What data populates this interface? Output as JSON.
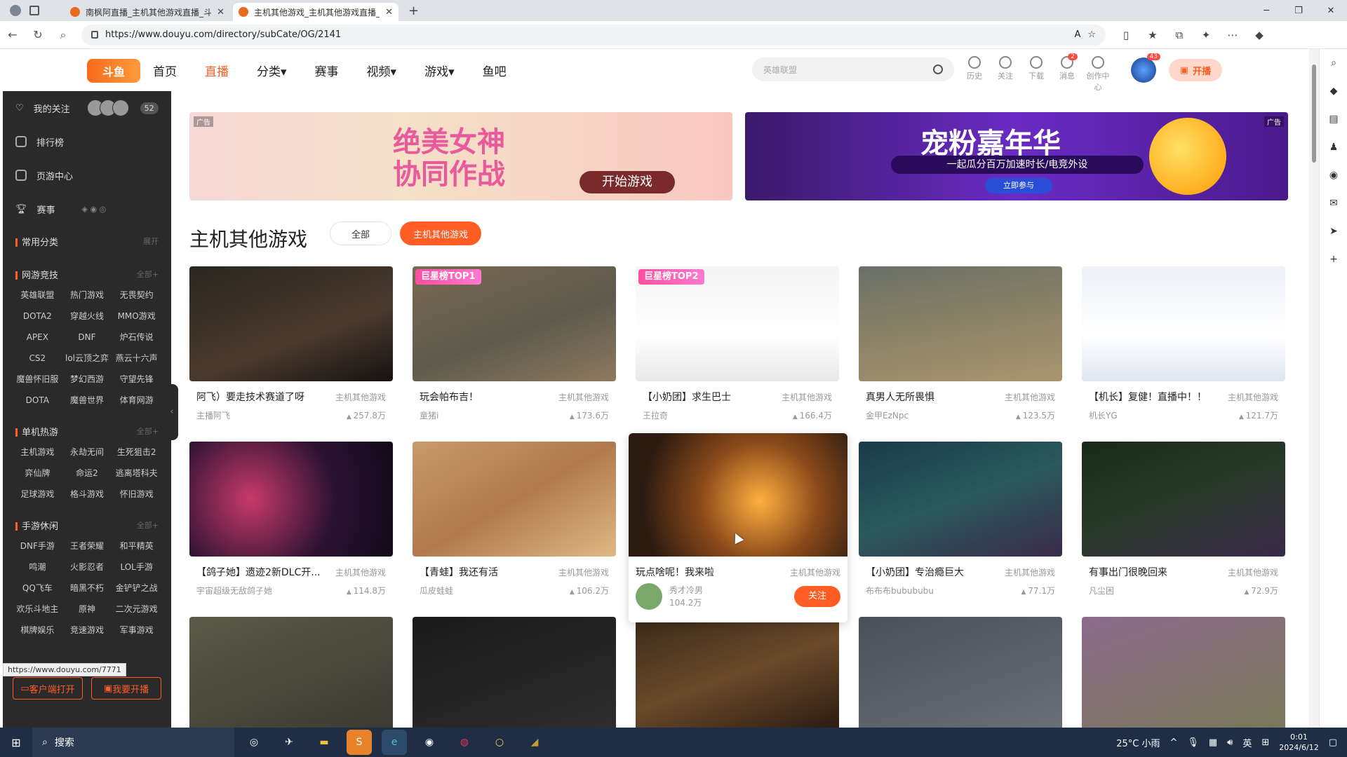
{
  "browser": {
    "tabs": [
      {
        "title": "南枫阿直播_主机其他游戏直播_斗鱼直播",
        "active": false
      },
      {
        "title": "主机其他游戏_主机其他游戏直播_斗鱼直播",
        "active": true
      }
    ],
    "url": "https://www.douyu.com/directory/subCate/OG/2141",
    "status_url": "https://www.douyu.com/7771"
  },
  "header": {
    "logo": "斗鱼",
    "nav": [
      "首页",
      "直播",
      "分类▾",
      "赛事",
      "视频▾",
      "游戏▾",
      "鱼吧"
    ],
    "active_nav": "直播",
    "search_placeholder": "英雄联盟",
    "tools": [
      {
        "label": "历史",
        "icon": "clock-icon",
        "badge": ""
      },
      {
        "label": "关注",
        "icon": "heart-icon",
        "badge": ""
      },
      {
        "label": "下载",
        "icon": "download-icon",
        "badge": ""
      },
      {
        "label": "消息",
        "icon": "message-icon",
        "badge": "2"
      },
      {
        "label": "创作中心",
        "icon": "create-icon",
        "badge": ""
      }
    ],
    "avatar_badge": "43",
    "live_button": "开播"
  },
  "sidebar": {
    "follow_label": "我的关注",
    "follow_count": "52",
    "rank_label": "排行榜",
    "task_label": "页游中心",
    "match_label": "赛事",
    "common_label": "常用分类",
    "common_more": "展开",
    "sections": [
      {
        "title": "网游竞技",
        "more": "全部+",
        "items": [
          "英雄联盟",
          "热门游戏",
          "无畏契约",
          "DOTA2",
          "穿越火线",
          "MMO游戏",
          "APEX",
          "DNF",
          "炉石传说",
          "CS2",
          "lol云顶之弈",
          "燕云十六声",
          "魔兽怀旧服",
          "梦幻西游",
          "守望先锋",
          "DOTA",
          "魔兽世界",
          "体育网游"
        ]
      },
      {
        "title": "单机热游",
        "more": "全部+",
        "items": [
          "主机游戏",
          "永劫无间",
          "生死狙击2",
          "弈仙牌",
          "命运2",
          "逃离塔科夫",
          "足球游戏",
          "格斗游戏",
          "怀旧游戏"
        ]
      },
      {
        "title": "手游休闲",
        "more": "全部+",
        "items": [
          "DNF手游",
          "王者荣耀",
          "和平精英",
          "鸣潮",
          "火影忍者",
          "LOL手游",
          "QQ飞车",
          "暗黑不朽",
          "金铲铲之战",
          "欢乐斗地主",
          "原神",
          "二次元游戏",
          "棋牌娱乐",
          "竞速游戏",
          "军事游戏"
        ]
      }
    ],
    "btn_client": "客户端打开",
    "btn_live": "我要开播"
  },
  "banners": {
    "b1": {
      "ad": "广告",
      "title_l1": "绝美女神",
      "title_l2": "协同作战",
      "cta": "开始游戏"
    },
    "b2": {
      "ad": "广告",
      "title": "宠粉嘉年华",
      "sub": "一起瓜分百万加速时长/电竞外设",
      "cta": "立即参与"
    }
  },
  "page": {
    "title": "主机其他游戏",
    "filter_all": "全部",
    "filter_current": "主机其他游戏"
  },
  "streams": [
    {
      "title": "阿飞）要走技术赛道了呀",
      "category": "主机其他游戏",
      "streamer": "主播阿飞",
      "hot": "257.8万",
      "rank": ""
    },
    {
      "title": "玩会帕布吉！",
      "category": "主机其他游戏",
      "streamer": "童猪i",
      "hot": "173.6万",
      "rank": "巨星榜TOP1"
    },
    {
      "title": "【小奶团】求生巴士",
      "category": "主机其他游戏",
      "streamer": "王拉奇",
      "hot": "166.4万",
      "rank": "巨星榜TOP2"
    },
    {
      "title": "真男人无所畏惧",
      "category": "主机其他游戏",
      "streamer": "金甲EzNpc",
      "hot": "123.5万",
      "rank": ""
    },
    {
      "title": "【机长】复健！直播中！！",
      "category": "主机其他游戏",
      "streamer": "机长YG",
      "hot": "121.7万",
      "rank": ""
    },
    {
      "title": "【鸽子她】遗迹2新DLC开...",
      "category": "主机其他游戏",
      "streamer": "宇宙超级无敌鸽子她",
      "hot": "114.8万",
      "rank": ""
    },
    {
      "title": "【青蛙】我还有活",
      "category": "主机其他游戏",
      "streamer": "瓜皮蛙蛙",
      "hot": "106.2万",
      "rank": ""
    },
    {
      "title": "玩点啥呢！我来啦",
      "category": "主机其他游戏",
      "streamer": "秀才冷男",
      "hot": "104.2万",
      "rank": ""
    },
    {
      "title": "【小奶团】专治瘾巨大",
      "category": "主机其他游戏",
      "streamer": "布布布bubububu",
      "hot": "77.1万",
      "rank": ""
    },
    {
      "title": "有事出门很晚回来",
      "category": "主机其他游戏",
      "streamer": "凡尘困",
      "hot": "72.9万",
      "rank": ""
    }
  ],
  "popover_follow": "关注",
  "colors": {
    "accent": "#ff5d23",
    "sidebar_bg": "#2a2a2a"
  },
  "taskbar": {
    "search": "搜索",
    "weather": "25°C 小雨",
    "ime": "英",
    "time": "0:01",
    "date": "2024/6/12"
  }
}
